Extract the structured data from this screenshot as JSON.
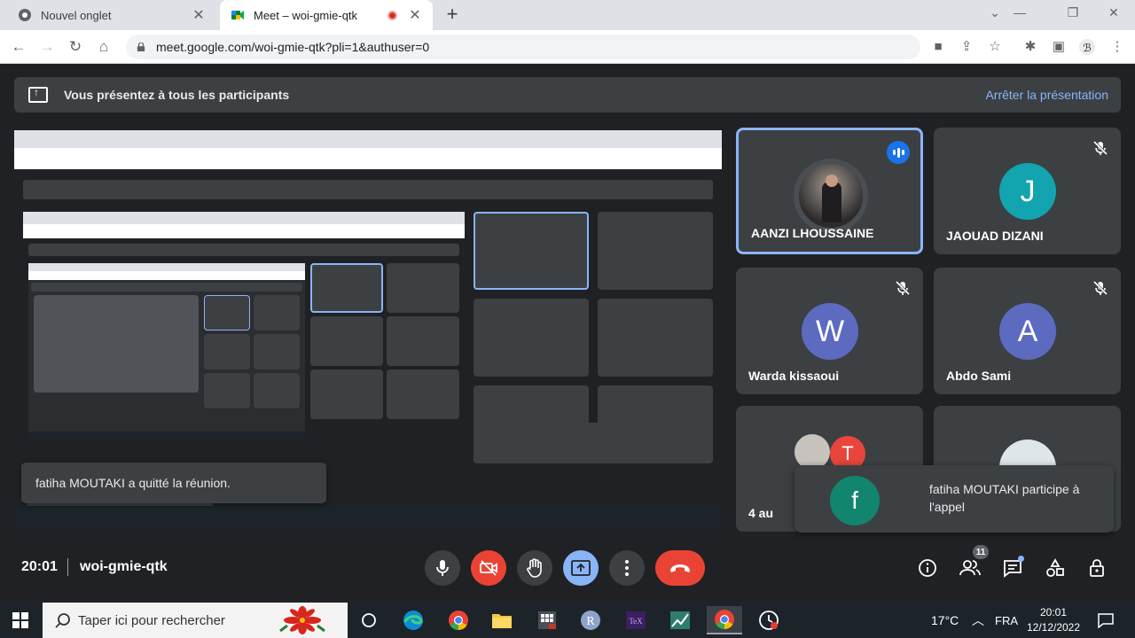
{
  "browser": {
    "tabs": [
      {
        "title": "Nouvel onglet",
        "active": false
      },
      {
        "title": "Meet – woi-gmie-qtk",
        "active": true
      }
    ],
    "url": "meet.google.com/woi-gmie-qtk?pli=1&authuser=0"
  },
  "banner": {
    "text": "Vous présentez à tous les participants",
    "stop_label": "Arrêter la présentation"
  },
  "participants": [
    {
      "name": "AANZI LHOUSSAINE",
      "avatar": "photo",
      "speaking": true
    },
    {
      "name": "JAOUAD DIZANI",
      "initial": "J",
      "color": "#12a4af",
      "muted": true
    },
    {
      "name": "Warda kissaoui",
      "initial": "W",
      "color": "#5c6bc0",
      "muted": true
    },
    {
      "name": "Abdo Sami",
      "initial": "A",
      "color": "#5c6bc0",
      "muted": true
    },
    {
      "name": "4 au",
      "initial": "T",
      "color": "#e8453c"
    }
  ],
  "toasts": {
    "left": "fatiha MOUTAKI a quitté la réunion.",
    "right": "fatiha MOUTAKI participe à l'appel",
    "right_initial": "f"
  },
  "meeting": {
    "time": "20:01",
    "code": "woi-gmie-qtk",
    "people_count": "11"
  },
  "taskbar": {
    "search_placeholder": "Taper ici pour rechercher",
    "weather": "17°C",
    "language": "FRA",
    "time": "20:01",
    "date": "12/12/2022"
  },
  "colors": {
    "accent": "#8ab4f8",
    "danger": "#ea4335",
    "tile": "#3c4043",
    "bg": "#202124"
  }
}
